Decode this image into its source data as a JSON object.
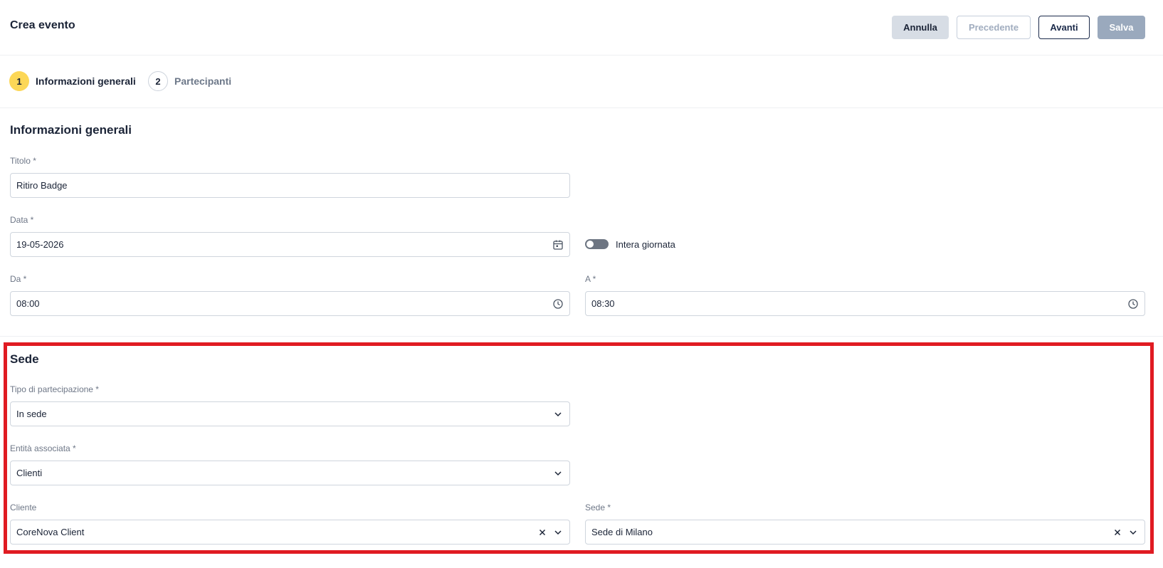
{
  "header": {
    "title": "Crea evento",
    "buttons": {
      "annulla": "Annulla",
      "precedente": "Precedente",
      "avanti": "Avanti",
      "salva": "Salva"
    }
  },
  "stepper": {
    "steps": [
      {
        "number": "1",
        "label": "Informazioni generali",
        "active": true
      },
      {
        "number": "2",
        "label": "Partecipanti",
        "active": false
      }
    ]
  },
  "general": {
    "section_title": "Informazioni generali",
    "titolo": {
      "label": "Titolo *",
      "value": "Ritiro Badge"
    },
    "data": {
      "label": "Data *",
      "value": "19-05-2026",
      "icon": "calendar-icon"
    },
    "intera_giornata": {
      "label": "Intera giornata",
      "checked": false
    },
    "da": {
      "label": "Da *",
      "value": "08:00",
      "icon": "clock-icon"
    },
    "a": {
      "label": "A *",
      "value": "08:30",
      "icon": "clock-icon"
    }
  },
  "sede": {
    "section_title": "Sede",
    "tipo": {
      "label": "Tipo di partecipazione *",
      "value": "In sede"
    },
    "entita": {
      "label": "Entità associata *",
      "value": "Clienti"
    },
    "cliente": {
      "label": "Cliente",
      "value": "CoreNova Client"
    },
    "sede_field": {
      "label": "Sede *",
      "value": "Sede di Milano"
    }
  },
  "colors": {
    "accent_step": "#fcd757",
    "primary_dark": "#1b2a4a",
    "highlight": "#e01b22",
    "toggle_off": "#6d7582"
  }
}
